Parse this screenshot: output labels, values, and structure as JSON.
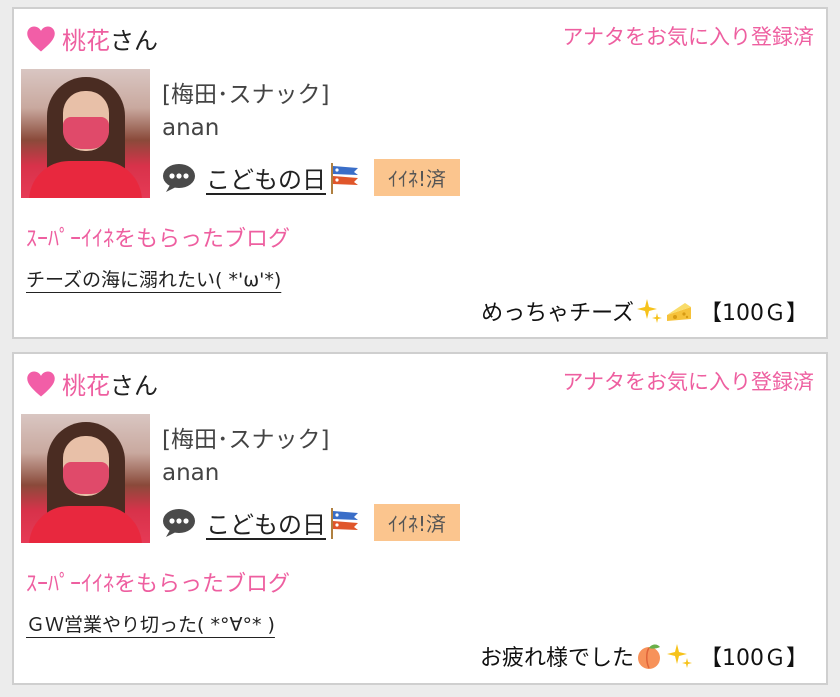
{
  "cards": [
    {
      "user_name": "桃花",
      "honorific": "さん",
      "fav_status": "アナタをお気に入り登録済",
      "shop": "[梅田･スナック]",
      "cast_name": "anan",
      "blog_title": "こどもの日",
      "iine_status": "ｲｲﾈ!済",
      "super_like_label": "ｽｰﾊﾟｰｲｲﾈをもらったブログ",
      "post_title": "チーズの海に溺れたい( *'ω'*)",
      "message": "めっちゃチーズ",
      "message_icons": [
        "sparkles-icon",
        "cheese-icon"
      ],
      "amount": "【100Ｇ】"
    },
    {
      "user_name": "桃花",
      "honorific": "さん",
      "fav_status": "アナタをお気に入り登録済",
      "shop": "[梅田･スナック]",
      "cast_name": "anan",
      "blog_title": "こどもの日",
      "iine_status": "ｲｲﾈ!済",
      "super_like_label": "ｽｰﾊﾟｰｲｲﾈをもらったブログ",
      "post_title": "ＧＷ営業やり切った( *°∀°* )",
      "message": "お疲れ様でした",
      "message_icons": [
        "peach-icon",
        "sparkles-icon"
      ],
      "amount": "【100Ｇ】"
    }
  ],
  "colors": {
    "accent_pink": "#ee5fa0",
    "iine_bg": "#fbc58e",
    "border": "#cfcfcf"
  }
}
